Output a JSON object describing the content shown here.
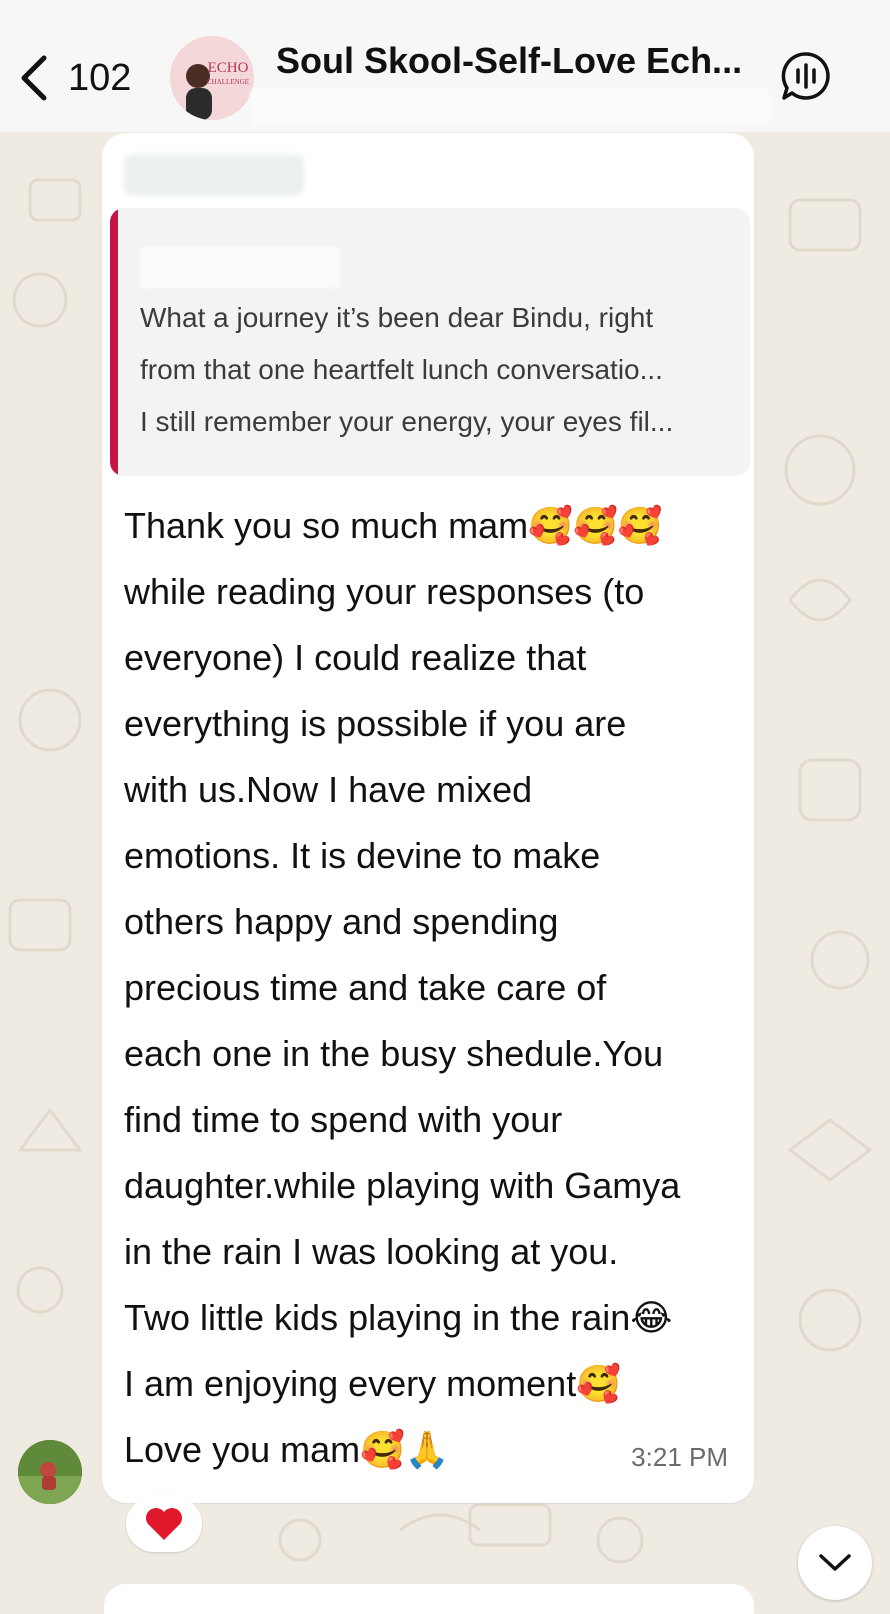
{
  "header": {
    "back_count": "102",
    "title": "Soul Skool-Self-Love Ech...",
    "avatar_text_top": "ECHO",
    "avatar_text_bottom": "CHALLENGE"
  },
  "quoted": {
    "lines": [
      "What a journey it’s been dear Bindu, right",
      "from that one heartfelt lunch conversatio...",
      "I still remember your energy, your eyes fil..."
    ]
  },
  "message": {
    "lines": [
      "Thank you so much mam🥰🥰🥰",
      "while reading your responses  (to",
      "everyone)  I could realize that",
      "everything is possible if you are",
      "with us.Now I have mixed",
      "emotions. It is devine to make",
      "others happy and spending",
      "precious time and take care of",
      "each one in the busy shedule.You",
      "find time to spend with your",
      "daughter.while playing with Gamya",
      "in the rain I was looking at you.",
      "Two little kids playing in the rain😂",
      "I am enjoying every moment🥰",
      "Love you mam🥰🙏"
    ],
    "time": "3:21 PM"
  },
  "reaction": {
    "emoji": "❤️"
  },
  "colors": {
    "quote_bar": "#c31546",
    "bubble": "#ffffff",
    "wallpaper": "#efeae2"
  }
}
